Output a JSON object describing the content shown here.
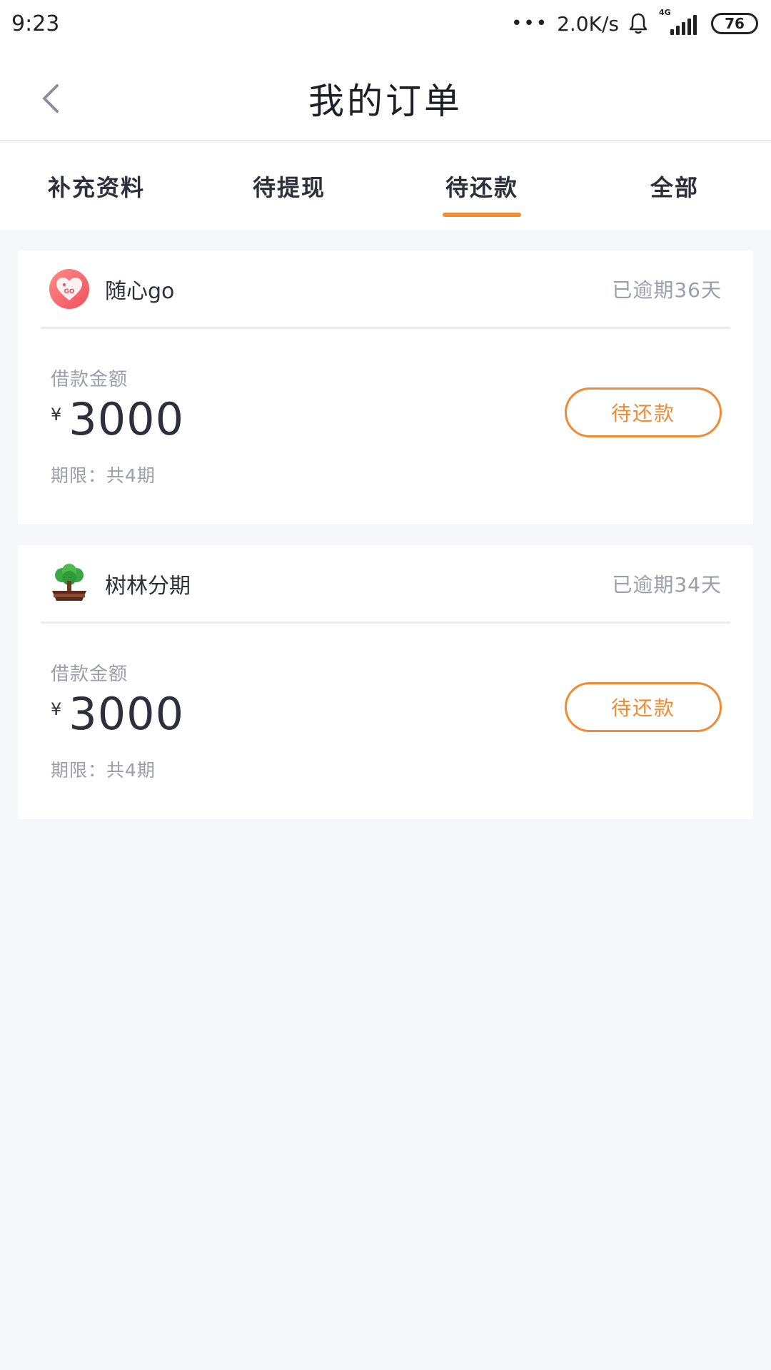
{
  "status_bar": {
    "time": "9:23",
    "dots": "•••",
    "speed": "2.0K/s",
    "network": "4G",
    "battery": "76"
  },
  "header": {
    "title": "我的订单"
  },
  "tabs": [
    {
      "label": "补充资料",
      "active": false
    },
    {
      "label": "待提现",
      "active": false
    },
    {
      "label": "待还款",
      "active": true
    },
    {
      "label": "全部",
      "active": false
    }
  ],
  "orders": [
    {
      "brand": "随心go",
      "overdue": "已逾期36天",
      "amount_label": "借款金额",
      "currency": "¥",
      "amount": "3000",
      "term": "期限：共4期",
      "action": "待还款"
    },
    {
      "brand": "树林分期",
      "overdue": "已逾期34天",
      "amount_label": "借款金额",
      "currency": "¥",
      "amount": "3000",
      "term": "期限：共4期",
      "action": "待还款"
    }
  ],
  "colors": {
    "accent": "#f08a34",
    "background": "#f4f6f9",
    "muted_text": "#9b9cac"
  }
}
